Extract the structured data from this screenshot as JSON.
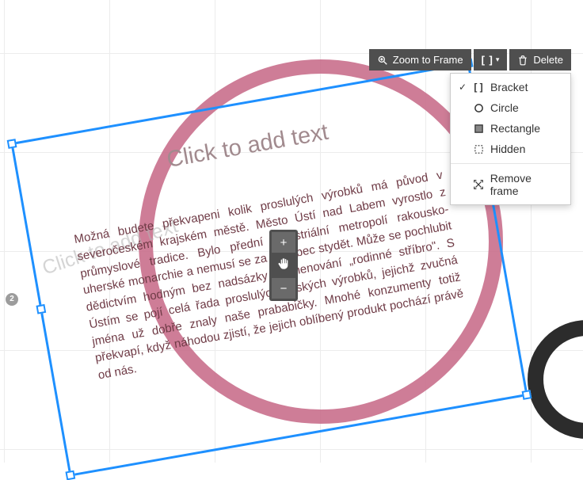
{
  "toolbar": {
    "zoom_to_frame": "Zoom to Frame",
    "delete": "Delete"
  },
  "frame_menu": {
    "bracket": "Bracket",
    "circle": "Circle",
    "rectangle": "Rectangle",
    "hidden": "Hidden",
    "remove_frame": "Remove frame",
    "selected": "bracket"
  },
  "frame": {
    "title_placeholder": "Click to add text",
    "body": "Možná budete překvapeni kolik proslulých výrobků má původ v severočeském krajském městě. Město Ústí nad Labem vyrostlo z průmyslové tradice. Bylo přední industriální metropolí rakousko-uherské monarchie a nemusí se za to vůbec stydět. Může se pochlubit dědictvím hodným bez nadsázky pojmenování „rodinné stříbro\". S Ústím se pojí celá řada proslulých českých výrobků, jejichž zvučná jména už dobře znaly naše prababičky. Mnohé konzumenty totiž překvapí, když náhodou zjistí, že jejich oblíbený produkt pochází právě od nás."
  },
  "background": {
    "back_placeholder": "Click to add text",
    "page_number": "2"
  },
  "zoom_controls": {
    "zoom_in": "+",
    "zoom_out": "−"
  }
}
